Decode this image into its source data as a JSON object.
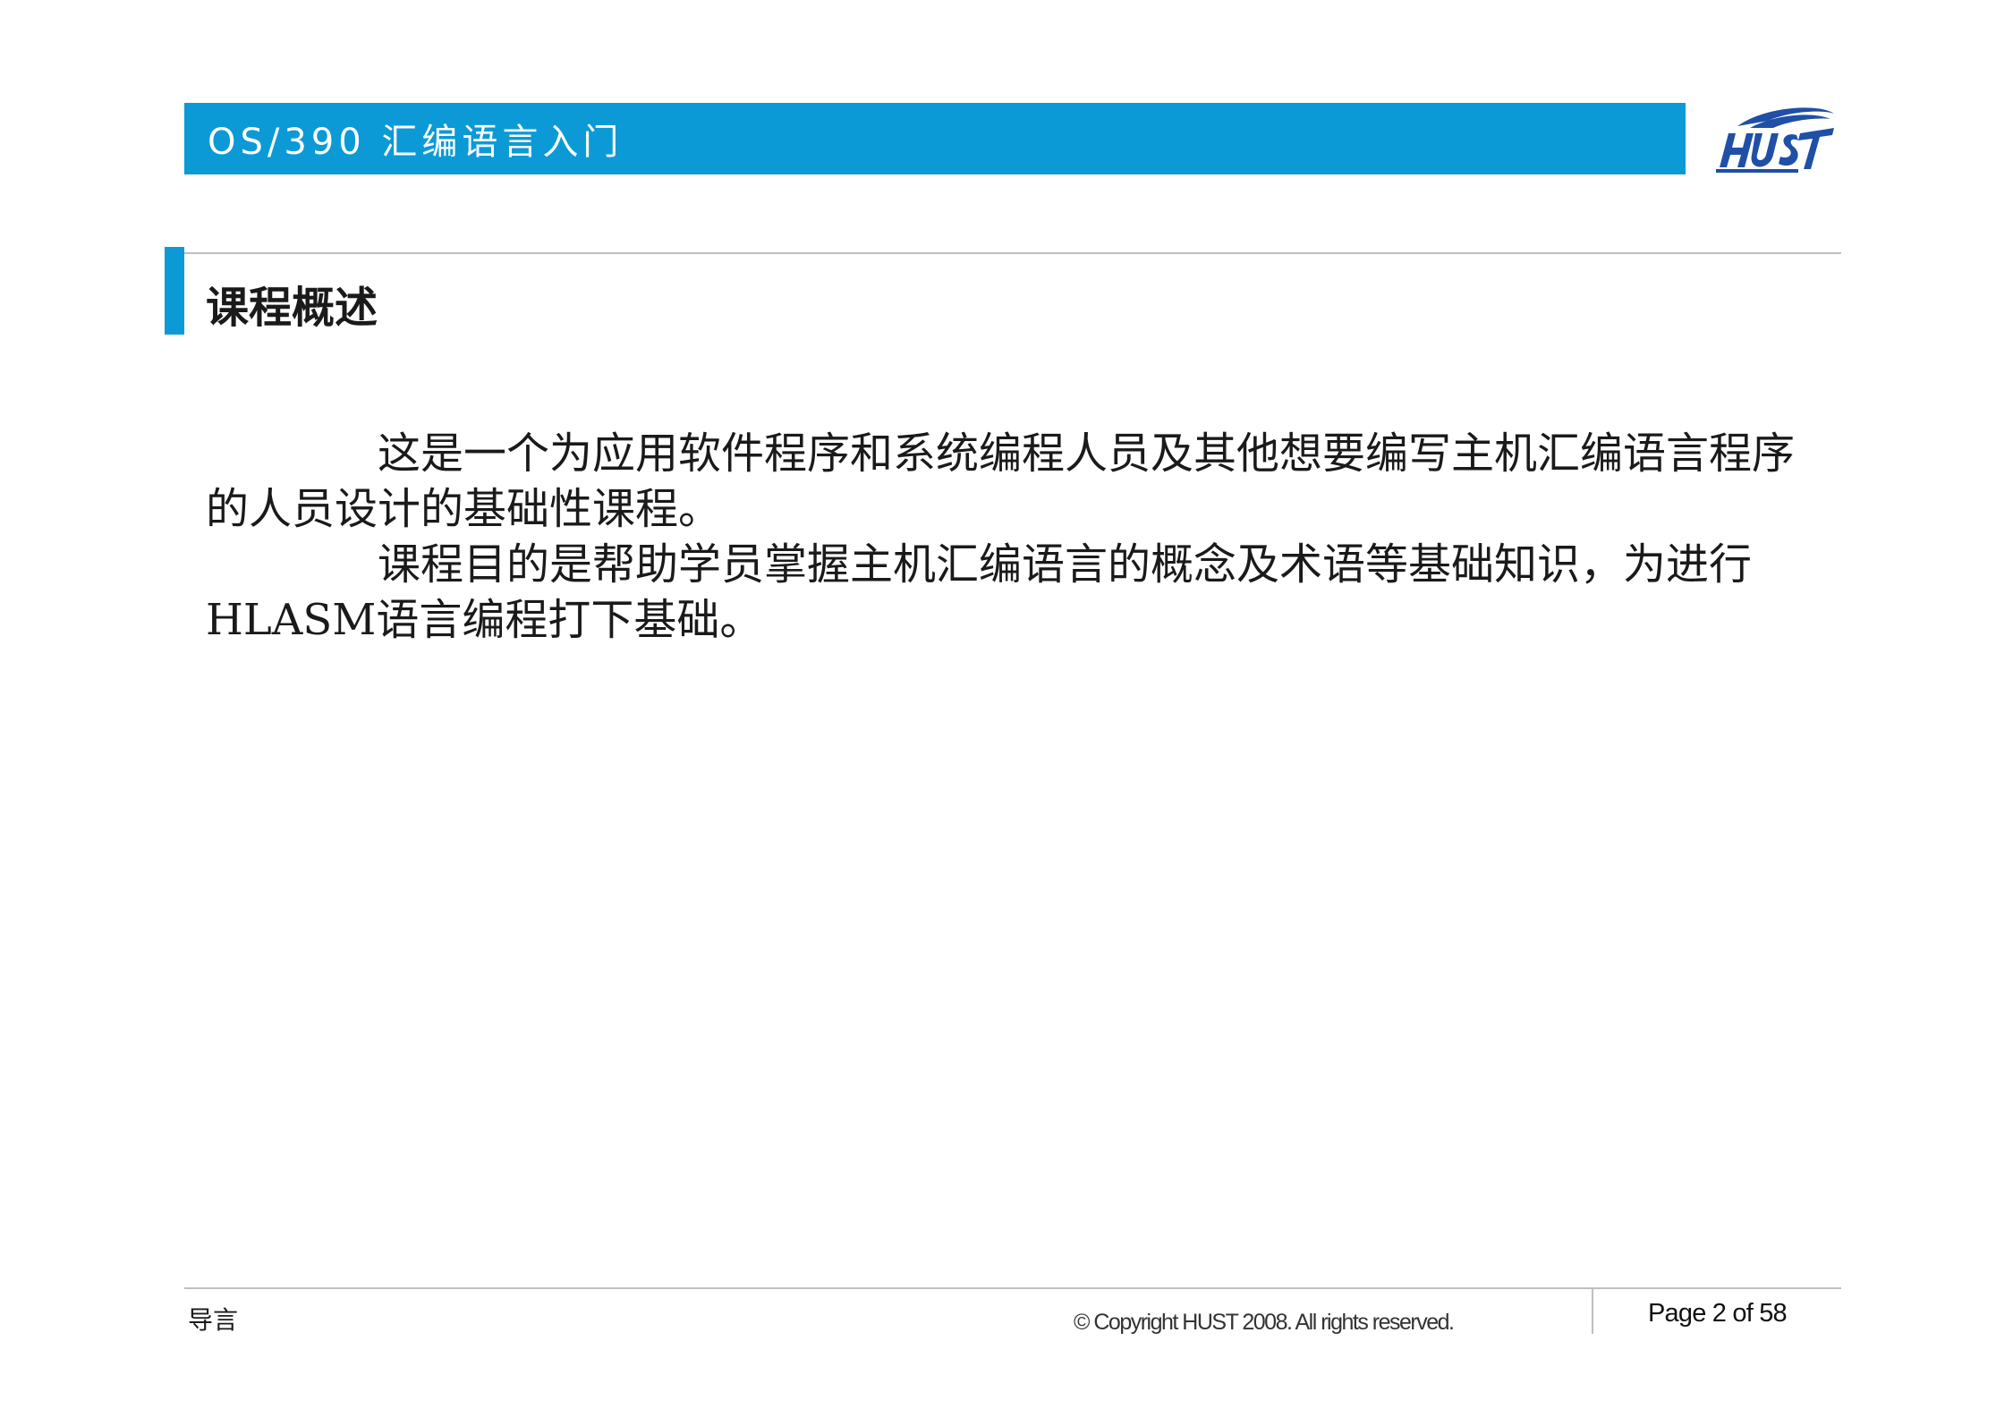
{
  "header": {
    "title": "OS/390 汇编语言入门",
    "bar_color": "#0b9ad6"
  },
  "logo": {
    "icon": "hust-logo",
    "text": "HUST",
    "color": "#1f4fa6"
  },
  "section": {
    "heading": "课程概述",
    "accent_color": "#0b9ad6"
  },
  "body": {
    "paragraphs": [
      "这是一个为应用软件程序和系统编程人员及其他想要编写主机汇编语言程序的人员设计的基础性课程。",
      "课程目的是帮助学员掌握主机汇编语言的概念及术语等基础知识，为进行HLASM语言编程打下基础。"
    ]
  },
  "footer": {
    "left_label": "导言",
    "copyright": "© Copyright HUST 2008. All rights reserved.",
    "page_indicator": "Page 2 of 58"
  }
}
